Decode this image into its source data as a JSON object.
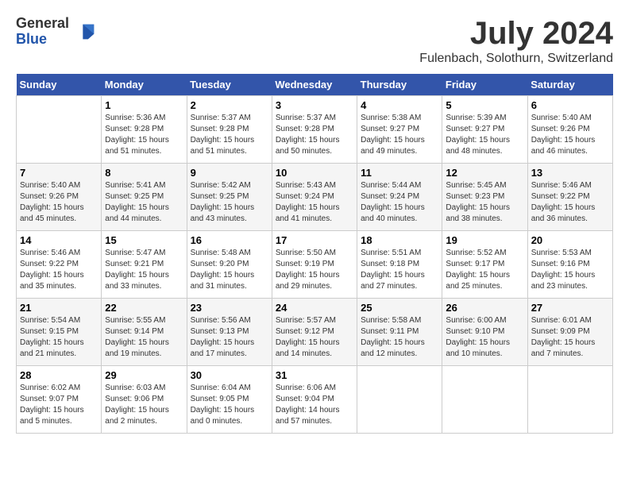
{
  "header": {
    "logo_general": "General",
    "logo_blue": "Blue",
    "month_title": "July 2024",
    "location": "Fulenbach, Solothurn, Switzerland"
  },
  "weekdays": [
    "Sunday",
    "Monday",
    "Tuesday",
    "Wednesday",
    "Thursday",
    "Friday",
    "Saturday"
  ],
  "weeks": [
    [
      {
        "day": "",
        "info": ""
      },
      {
        "day": "1",
        "info": "Sunrise: 5:36 AM\nSunset: 9:28 PM\nDaylight: 15 hours\nand 51 minutes."
      },
      {
        "day": "2",
        "info": "Sunrise: 5:37 AM\nSunset: 9:28 PM\nDaylight: 15 hours\nand 51 minutes."
      },
      {
        "day": "3",
        "info": "Sunrise: 5:37 AM\nSunset: 9:28 PM\nDaylight: 15 hours\nand 50 minutes."
      },
      {
        "day": "4",
        "info": "Sunrise: 5:38 AM\nSunset: 9:27 PM\nDaylight: 15 hours\nand 49 minutes."
      },
      {
        "day": "5",
        "info": "Sunrise: 5:39 AM\nSunset: 9:27 PM\nDaylight: 15 hours\nand 48 minutes."
      },
      {
        "day": "6",
        "info": "Sunrise: 5:40 AM\nSunset: 9:26 PM\nDaylight: 15 hours\nand 46 minutes."
      }
    ],
    [
      {
        "day": "7",
        "info": "Sunrise: 5:40 AM\nSunset: 9:26 PM\nDaylight: 15 hours\nand 45 minutes."
      },
      {
        "day": "8",
        "info": "Sunrise: 5:41 AM\nSunset: 9:25 PM\nDaylight: 15 hours\nand 44 minutes."
      },
      {
        "day": "9",
        "info": "Sunrise: 5:42 AM\nSunset: 9:25 PM\nDaylight: 15 hours\nand 43 minutes."
      },
      {
        "day": "10",
        "info": "Sunrise: 5:43 AM\nSunset: 9:24 PM\nDaylight: 15 hours\nand 41 minutes."
      },
      {
        "day": "11",
        "info": "Sunrise: 5:44 AM\nSunset: 9:24 PM\nDaylight: 15 hours\nand 40 minutes."
      },
      {
        "day": "12",
        "info": "Sunrise: 5:45 AM\nSunset: 9:23 PM\nDaylight: 15 hours\nand 38 minutes."
      },
      {
        "day": "13",
        "info": "Sunrise: 5:46 AM\nSunset: 9:22 PM\nDaylight: 15 hours\nand 36 minutes."
      }
    ],
    [
      {
        "day": "14",
        "info": "Sunrise: 5:46 AM\nSunset: 9:22 PM\nDaylight: 15 hours\nand 35 minutes."
      },
      {
        "day": "15",
        "info": "Sunrise: 5:47 AM\nSunset: 9:21 PM\nDaylight: 15 hours\nand 33 minutes."
      },
      {
        "day": "16",
        "info": "Sunrise: 5:48 AM\nSunset: 9:20 PM\nDaylight: 15 hours\nand 31 minutes."
      },
      {
        "day": "17",
        "info": "Sunrise: 5:50 AM\nSunset: 9:19 PM\nDaylight: 15 hours\nand 29 minutes."
      },
      {
        "day": "18",
        "info": "Sunrise: 5:51 AM\nSunset: 9:18 PM\nDaylight: 15 hours\nand 27 minutes."
      },
      {
        "day": "19",
        "info": "Sunrise: 5:52 AM\nSunset: 9:17 PM\nDaylight: 15 hours\nand 25 minutes."
      },
      {
        "day": "20",
        "info": "Sunrise: 5:53 AM\nSunset: 9:16 PM\nDaylight: 15 hours\nand 23 minutes."
      }
    ],
    [
      {
        "day": "21",
        "info": "Sunrise: 5:54 AM\nSunset: 9:15 PM\nDaylight: 15 hours\nand 21 minutes."
      },
      {
        "day": "22",
        "info": "Sunrise: 5:55 AM\nSunset: 9:14 PM\nDaylight: 15 hours\nand 19 minutes."
      },
      {
        "day": "23",
        "info": "Sunrise: 5:56 AM\nSunset: 9:13 PM\nDaylight: 15 hours\nand 17 minutes."
      },
      {
        "day": "24",
        "info": "Sunrise: 5:57 AM\nSunset: 9:12 PM\nDaylight: 15 hours\nand 14 minutes."
      },
      {
        "day": "25",
        "info": "Sunrise: 5:58 AM\nSunset: 9:11 PM\nDaylight: 15 hours\nand 12 minutes."
      },
      {
        "day": "26",
        "info": "Sunrise: 6:00 AM\nSunset: 9:10 PM\nDaylight: 15 hours\nand 10 minutes."
      },
      {
        "day": "27",
        "info": "Sunrise: 6:01 AM\nSunset: 9:09 PM\nDaylight: 15 hours\nand 7 minutes."
      }
    ],
    [
      {
        "day": "28",
        "info": "Sunrise: 6:02 AM\nSunset: 9:07 PM\nDaylight: 15 hours\nand 5 minutes."
      },
      {
        "day": "29",
        "info": "Sunrise: 6:03 AM\nSunset: 9:06 PM\nDaylight: 15 hours\nand 2 minutes."
      },
      {
        "day": "30",
        "info": "Sunrise: 6:04 AM\nSunset: 9:05 PM\nDaylight: 15 hours\nand 0 minutes."
      },
      {
        "day": "31",
        "info": "Sunrise: 6:06 AM\nSunset: 9:04 PM\nDaylight: 14 hours\nand 57 minutes."
      },
      {
        "day": "",
        "info": ""
      },
      {
        "day": "",
        "info": ""
      },
      {
        "day": "",
        "info": ""
      }
    ]
  ]
}
